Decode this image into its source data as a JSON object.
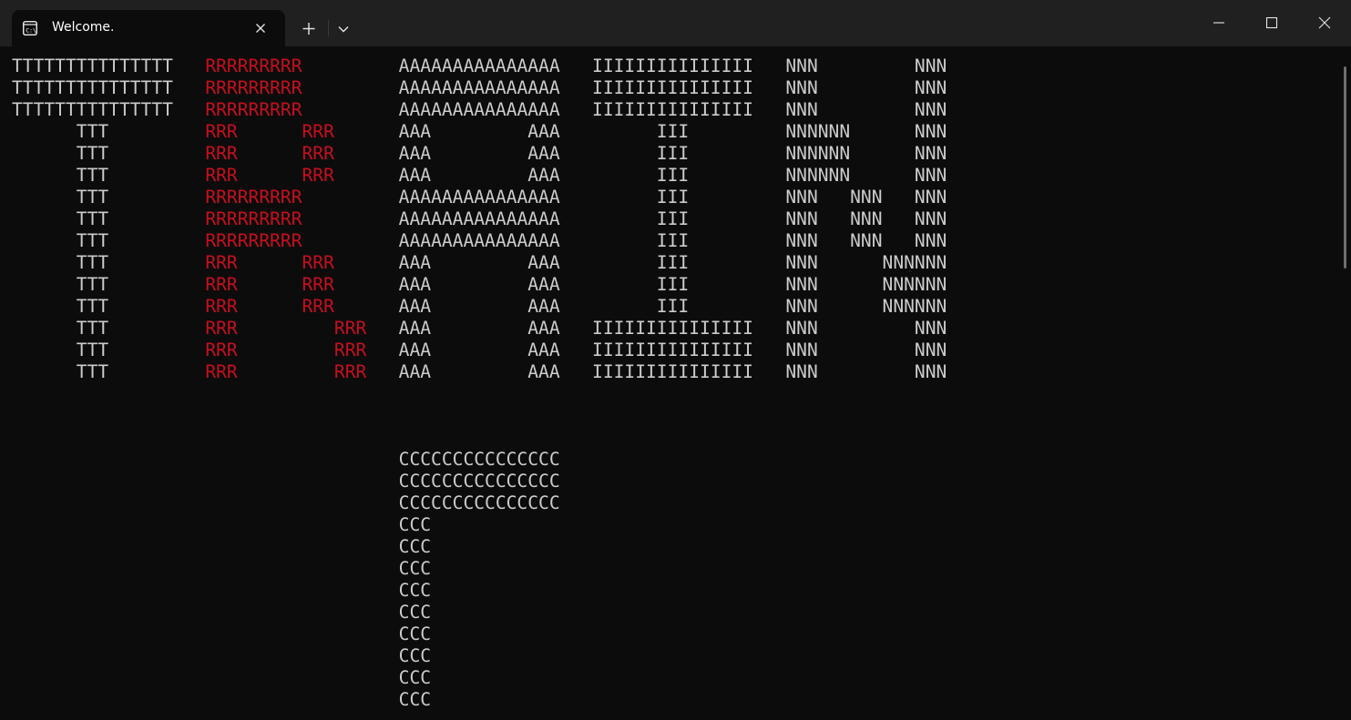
{
  "window": {
    "tab_title": "Welcome.",
    "tab_icon": "command-prompt-icon",
    "new_tab_icon": "plus-icon",
    "dropdown_icon": "chevron-down-icon",
    "minimize_icon": "minimize-icon",
    "maximize_icon": "maximize-icon",
    "close_icon": "close-icon"
  },
  "colors": {
    "background": "#0c0c0c",
    "titlebar": "#202020",
    "text": "#cccccc",
    "accent_red": "#c50f1f"
  },
  "terminal": {
    "lines": [
      {
        "t": "TTTTTTTTTTTTTTT   ",
        "r": "RRRRRRRRR",
        "rest": "         AAAAAAAAAAAAAAA   IIIIIIIIIIIIIII   NNN         NNN"
      },
      {
        "t": "TTTTTTTTTTTTTTT   ",
        "r": "RRRRRRRRR",
        "rest": "         AAAAAAAAAAAAAAA   IIIIIIIIIIIIIII   NNN         NNN"
      },
      {
        "t": "TTTTTTTTTTTTTTT   ",
        "r": "RRRRRRRRR",
        "rest": "         AAAAAAAAAAAAAAA   IIIIIIIIIIIIIII   NNN         NNN"
      },
      {
        "t": "      TTT         ",
        "r": "RRR      RRR",
        "rest": "      AAA         AAA         III         NNNNNN      NNN"
      },
      {
        "t": "      TTT         ",
        "r": "RRR      RRR",
        "rest": "      AAA         AAA         III         NNNNNN      NNN"
      },
      {
        "t": "      TTT         ",
        "r": "RRR      RRR",
        "rest": "      AAA         AAA         III         NNNNNN      NNN"
      },
      {
        "t": "      TTT         ",
        "r": "RRRRRRRRR",
        "rest": "         AAAAAAAAAAAAAAA         III         NNN   NNN   NNN"
      },
      {
        "t": "      TTT         ",
        "r": "RRRRRRRRR",
        "rest": "         AAAAAAAAAAAAAAA         III         NNN   NNN   NNN"
      },
      {
        "t": "      TTT         ",
        "r": "RRRRRRRRR",
        "rest": "         AAAAAAAAAAAAAAA         III         NNN   NNN   NNN"
      },
      {
        "t": "      TTT         ",
        "r": "RRR      RRR",
        "rest": "      AAA         AAA         III         NNN      NNNNNN"
      },
      {
        "t": "      TTT         ",
        "r": "RRR      RRR",
        "rest": "      AAA         AAA         III         NNN      NNNNNN"
      },
      {
        "t": "      TTT         ",
        "r": "RRR      RRR",
        "rest": "      AAA         AAA         III         NNN      NNNNNN"
      },
      {
        "t": "      TTT         ",
        "r": "RRR         RRR",
        "rest": "   AAA         AAA   IIIIIIIIIIIIIII   NNN         NNN"
      },
      {
        "t": "      TTT         ",
        "r": "RRR         RRR",
        "rest": "   AAA         AAA   IIIIIIIIIIIIIII   NNN         NNN"
      },
      {
        "t": "      TTT         ",
        "r": "RRR         RRR",
        "rest": "   AAA         AAA   IIIIIIIIIIIIIII   NNN         NNN"
      },
      {
        "t": "",
        "r": "",
        "rest": ""
      },
      {
        "t": "",
        "r": "",
        "rest": ""
      },
      {
        "t": "",
        "r": "",
        "rest": ""
      },
      {
        "t": "",
        "r": "",
        "rest": "                                    CCCCCCCCCCCCCCC"
      },
      {
        "t": "",
        "r": "",
        "rest": "                                    CCCCCCCCCCCCCCC"
      },
      {
        "t": "",
        "r": "",
        "rest": "                                    CCCCCCCCCCCCCCC"
      },
      {
        "t": "",
        "r": "",
        "rest": "                                    CCC"
      },
      {
        "t": "",
        "r": "",
        "rest": "                                    CCC"
      },
      {
        "t": "",
        "r": "",
        "rest": "                                    CCC"
      },
      {
        "t": "",
        "r": "",
        "rest": "                                    CCC"
      },
      {
        "t": "",
        "r": "",
        "rest": "                                    CCC"
      },
      {
        "t": "",
        "r": "",
        "rest": "                                    CCC"
      },
      {
        "t": "",
        "r": "",
        "rest": "                                    CCC"
      },
      {
        "t": "",
        "r": "",
        "rest": "                                    CCC"
      },
      {
        "t": "",
        "r": "",
        "rest": "                                    CCC"
      }
    ]
  }
}
